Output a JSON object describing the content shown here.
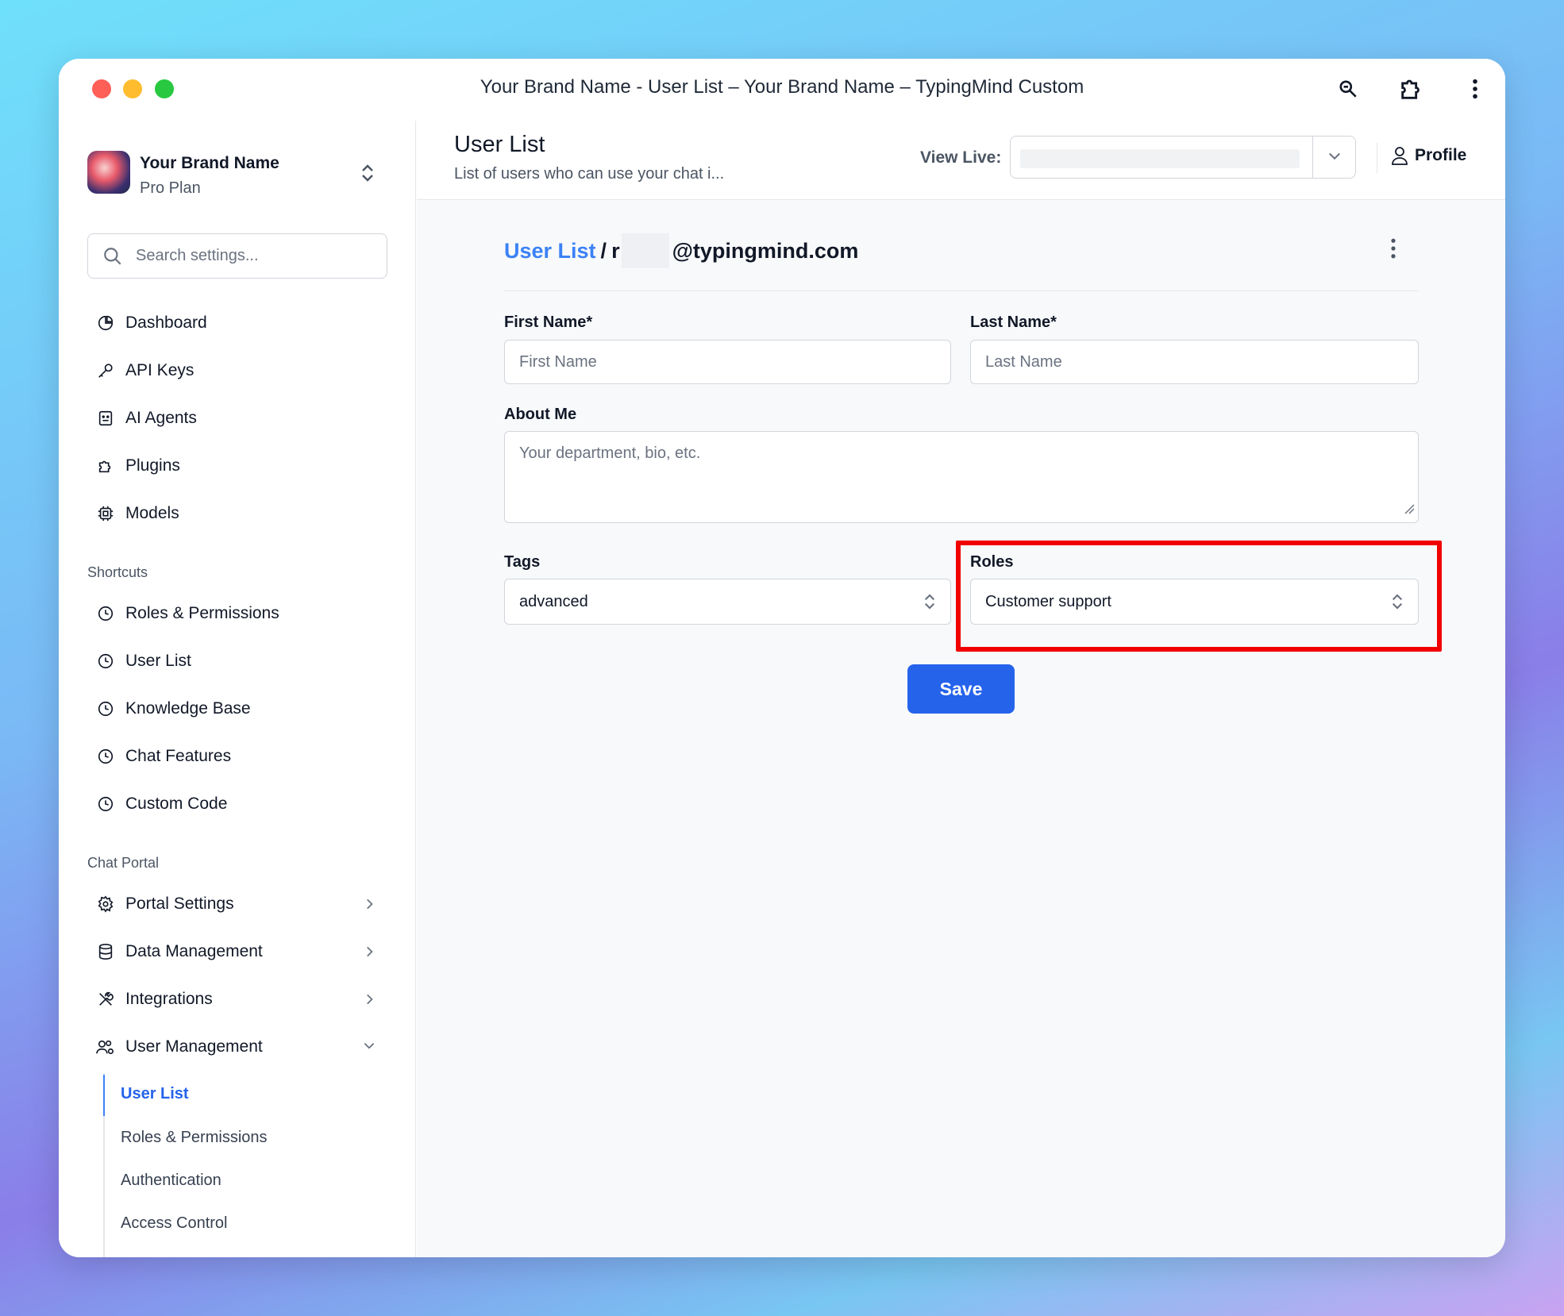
{
  "window": {
    "title": "Your Brand Name - User List – Your Brand Name – TypingMind Custom"
  },
  "brand": {
    "name": "Your Brand Name",
    "plan": "Pro Plan"
  },
  "search": {
    "placeholder": "Search settings..."
  },
  "sidebar": {
    "main_items": [
      {
        "label": "Dashboard",
        "icon": "pie-chart-icon"
      },
      {
        "label": "API Keys",
        "icon": "key-icon"
      },
      {
        "label": "AI Agents",
        "icon": "agent-icon"
      },
      {
        "label": "Plugins",
        "icon": "puzzle-icon"
      },
      {
        "label": "Models",
        "icon": "chip-icon"
      }
    ],
    "shortcuts_label": "Shortcuts",
    "shortcuts": [
      {
        "label": "Roles & Permissions",
        "icon": "clock-icon"
      },
      {
        "label": "User List",
        "icon": "clock-icon"
      },
      {
        "label": "Knowledge Base",
        "icon": "clock-icon"
      },
      {
        "label": "Chat Features",
        "icon": "clock-icon"
      },
      {
        "label": "Custom Code",
        "icon": "clock-icon"
      }
    ],
    "portal_label": "Chat Portal",
    "portal_items": [
      {
        "label": "Portal Settings",
        "icon": "gear-icon"
      },
      {
        "label": "Data Management",
        "icon": "database-icon"
      },
      {
        "label": "Integrations",
        "icon": "tools-icon"
      },
      {
        "label": "User Management",
        "icon": "users-icon"
      }
    ],
    "user_management_sub": [
      {
        "label": "User List",
        "active": true
      },
      {
        "label": "Roles & Permissions",
        "active": false
      },
      {
        "label": "Authentication",
        "active": false
      },
      {
        "label": "Access Control",
        "active": false
      }
    ]
  },
  "header": {
    "title": "User List",
    "subtitle": "List of users who can use your chat i...",
    "view_live_label": "View Live:",
    "profile_label": "Profile"
  },
  "breadcrumb": {
    "link": "User List",
    "separator": "/",
    "prefix": "r",
    "email": "@typingmind.com"
  },
  "form": {
    "first_name": {
      "label": "First Name*",
      "placeholder": "First Name"
    },
    "last_name": {
      "label": "Last Name*",
      "placeholder": "Last Name"
    },
    "about": {
      "label": "About Me",
      "placeholder": "Your department, bio, etc."
    },
    "tags": {
      "label": "Tags",
      "value": "advanced"
    },
    "roles": {
      "label": "Roles",
      "value": "Customer support"
    },
    "save_label": "Save"
  },
  "colors": {
    "accent": "#2563eb",
    "link": "#3b82f6",
    "highlight": "#f10000"
  }
}
